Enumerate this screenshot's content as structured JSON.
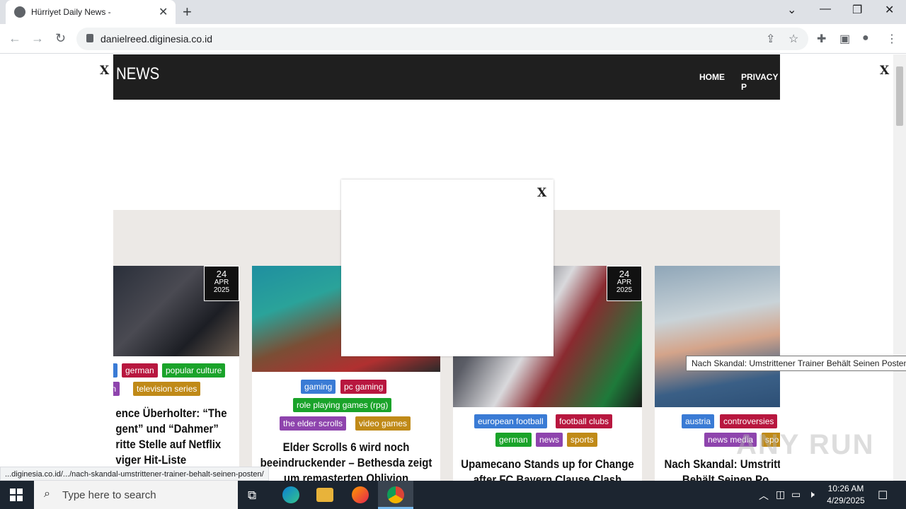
{
  "browser": {
    "tab_title": "Hürriyet Daily News -",
    "tab_close": "✕",
    "new_tab": "+",
    "url": "danielreed.diginesia.co.id",
    "window_controls": [
      "⌄",
      "—",
      "❐",
      "✕"
    ]
  },
  "site": {
    "logo": "NEWS",
    "nav": [
      "HOME",
      "PRIVACY P"
    ]
  },
  "overlays": {
    "left_close": "X",
    "right_close": "X",
    "popup_close": "X"
  },
  "cards": [
    {
      "date": {
        "day": "24",
        "month": "APR",
        "year": "2025"
      },
      "tags": [
        "german",
        "popular culture",
        "ion",
        "television series"
      ],
      "title_lines": [
        "ence Überholter: “The",
        "gent” und “Dahmer”",
        "ritte Stelle auf Netflix",
        "viger Hit-Liste"
      ]
    },
    {
      "tags": [
        "gaming",
        "pc gaming",
        "role playing games (rpg)",
        "the elder scrolls",
        "video games"
      ],
      "title_lines": [
        "Elder Scrolls 6 wird noch",
        "beeindruckender – Bethesda zeigt",
        "um remasterten Oblivion"
      ]
    },
    {
      "date": {
        "day": "24",
        "month": "APR",
        "year": "2025"
      },
      "tags": [
        "european football",
        "football clubs",
        "german",
        "news",
        "sports"
      ],
      "title_lines": [
        "Upamecano Stands up for Change",
        "after FC Bayern Clause Clash"
      ]
    },
    {
      "tags": [
        "austria",
        "controversies",
        "news media",
        "spo"
      ],
      "title_lines": [
        "Nach Skandal: Umstritte",
        "Behält Seinen Po"
      ]
    }
  ],
  "tooltip": "Nach Skandal: Umstrittener Trainer Behält Seinen Posten",
  "status_url": "...diginesia.co.id/.../nach-skandal-umstrittener-trainer-behalt-seinen-posten/",
  "watermark": "ANY RUN",
  "taskbar": {
    "search_placeholder": "Type here to search",
    "time": "10:26 AM",
    "date": "4/29/2025"
  },
  "colors": {
    "blue_tag": "#3a7bd5",
    "crimson_tag": "#b8173f",
    "green_tag": "#1aa32a",
    "purple_tag": "#8e44ad",
    "gold_tag": "#c08a18"
  }
}
